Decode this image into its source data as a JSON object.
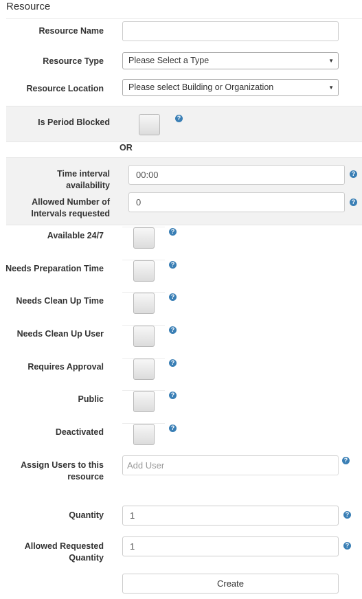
{
  "title": "Resource",
  "fields": {
    "resource_name": {
      "label": "Resource Name",
      "value": ""
    },
    "resource_type": {
      "label": "Resource Type",
      "selected": "Please Select a Type"
    },
    "resource_location": {
      "label": "Resource Location",
      "selected": "Please select Building or Organization"
    },
    "is_period_blocked": {
      "label": "Is Period Blocked"
    },
    "or_text": "OR",
    "time_interval": {
      "label_line1": "Time interval",
      "label_line2": "availability",
      "value": "00:00"
    },
    "allowed_intervals": {
      "label_line1": "Allowed Number of",
      "label_line2": "Intervals requested",
      "value": "0"
    },
    "available_247": {
      "label": "Available 24/7"
    },
    "needs_prep": {
      "label": "Needs Preparation Time"
    },
    "needs_cleanup_time": {
      "label": "Needs Clean Up Time"
    },
    "needs_cleanup_user": {
      "label": "Needs Clean Up User"
    },
    "requires_approval": {
      "label": "Requires Approval"
    },
    "public": {
      "label": "Public"
    },
    "deactivated": {
      "label": "Deactivated"
    },
    "assign_users": {
      "label_line1": "Assign Users to this",
      "label_line2": "resource",
      "placeholder": "Add User"
    },
    "quantity": {
      "label": "Quantity",
      "value": "1"
    },
    "allowed_requested_quantity": {
      "label_line1": "Allowed Requested",
      "label_line2": "Quantity",
      "value": "1"
    }
  },
  "create_button": "Create",
  "help_glyph": "?",
  "caret_glyph": "▼",
  "colors": {
    "help": "#3a7fb5",
    "band": "#f2f2f2"
  }
}
